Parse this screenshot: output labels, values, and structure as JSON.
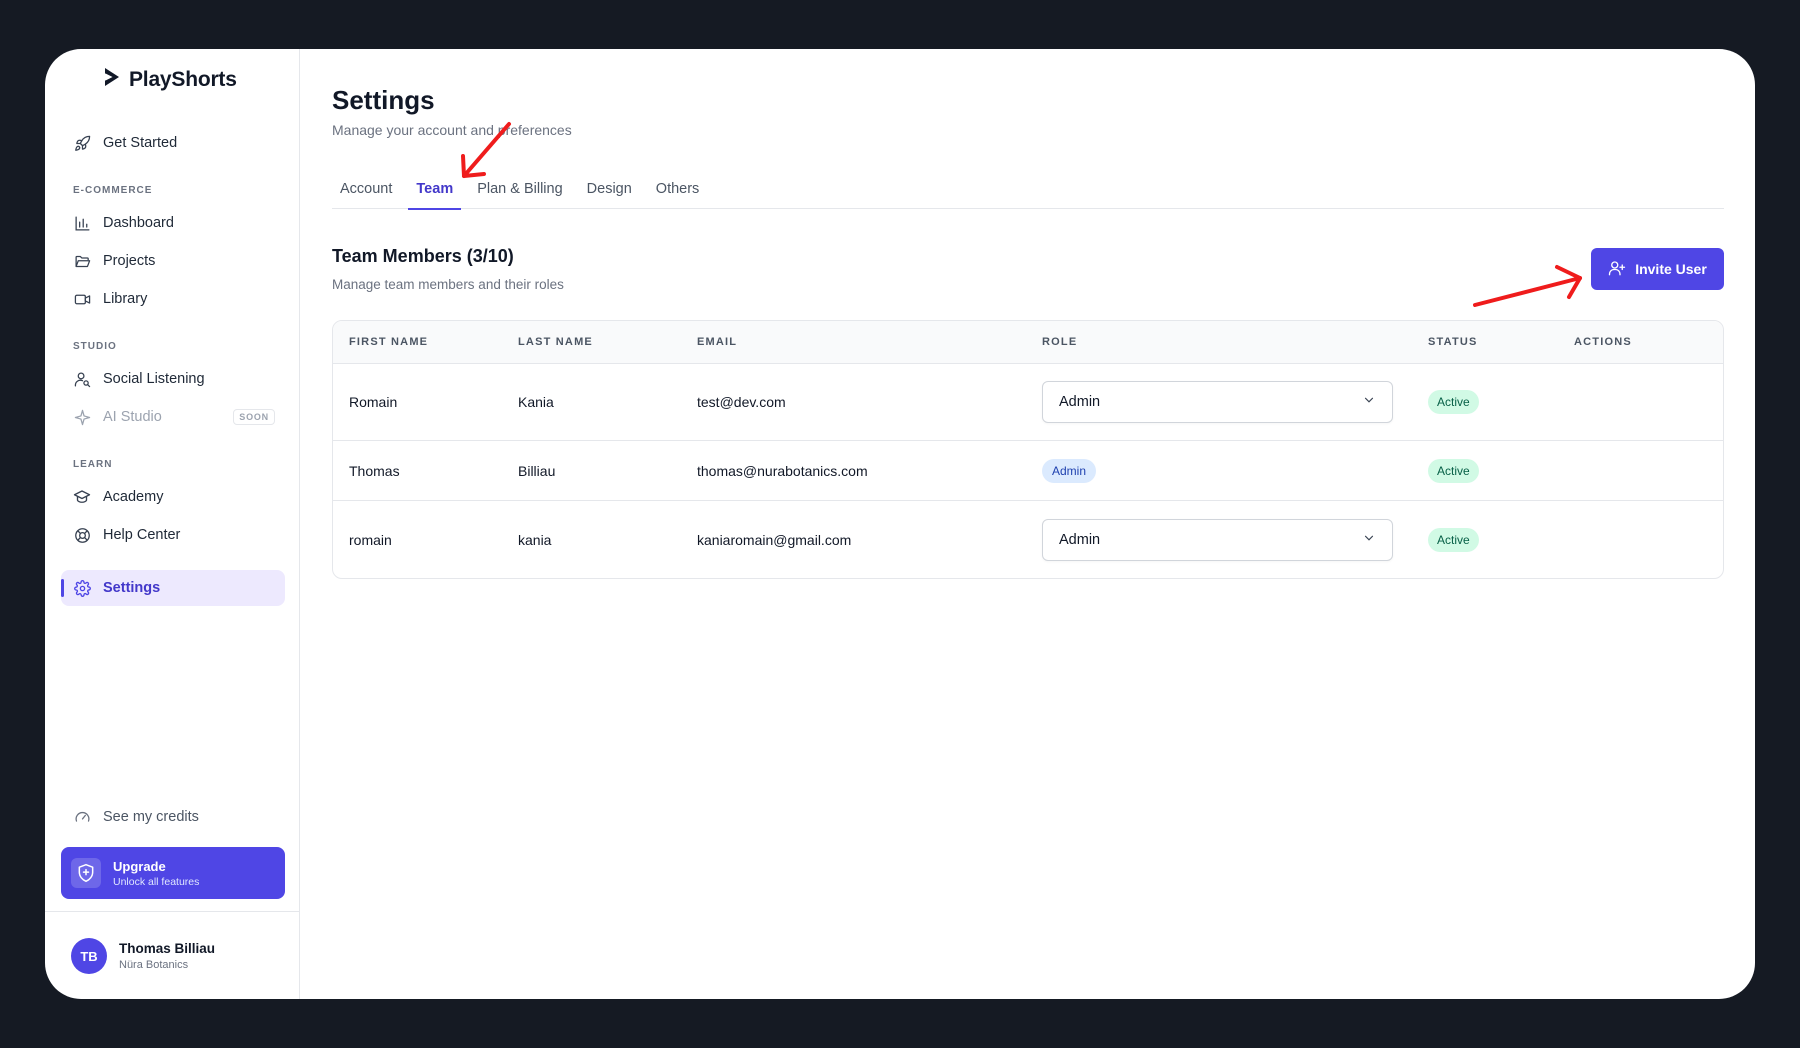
{
  "app": {
    "name": "PlayShorts"
  },
  "sidebar": {
    "get_started": "Get Started",
    "sections": [
      {
        "label": "E-COMMERCE",
        "items": [
          "Dashboard",
          "Projects",
          "Library"
        ]
      },
      {
        "label": "STUDIO",
        "items": [
          "Social Listening",
          "AI Studio"
        ]
      },
      {
        "label": "LEARN",
        "items": [
          "Academy",
          "Help Center"
        ]
      }
    ],
    "soon_badge": "SOON",
    "settings": "Settings",
    "credits": "See my credits",
    "upgrade": {
      "title": "Upgrade",
      "subtitle": "Unlock all features"
    },
    "user": {
      "initials": "TB",
      "name": "Thomas Billiau",
      "org": "Nüra Botanics"
    }
  },
  "page": {
    "title": "Settings",
    "subtitle": "Manage your account and preferences",
    "tabs": [
      "Account",
      "Team",
      "Plan & Billing",
      "Design",
      "Others"
    ],
    "active_tab": "Team"
  },
  "team": {
    "title": "Team Members (3/10)",
    "subtitle": "Manage team members and their roles",
    "invite_label": "Invite User",
    "columns": [
      "FIRST NAME",
      "LAST NAME",
      "EMAIL",
      "ROLE",
      "STATUS",
      "ACTIONS"
    ],
    "rows": [
      {
        "first": "Romain",
        "last": "Kania",
        "email": "test@dev.com",
        "role": "Admin",
        "role_type": "select",
        "status": "Active"
      },
      {
        "first": "Thomas",
        "last": "Billiau",
        "email": "thomas@nurabotanics.com",
        "role": "Admin",
        "role_type": "badge",
        "status": "Active"
      },
      {
        "first": "romain",
        "last": "kania",
        "email": "kaniaromain@gmail.com",
        "role": "Admin",
        "role_type": "select",
        "status": "Active"
      }
    ]
  },
  "colors": {
    "accent": "#4f46e5",
    "annotation": "#ef1c1c",
    "frame": "#151a23"
  }
}
